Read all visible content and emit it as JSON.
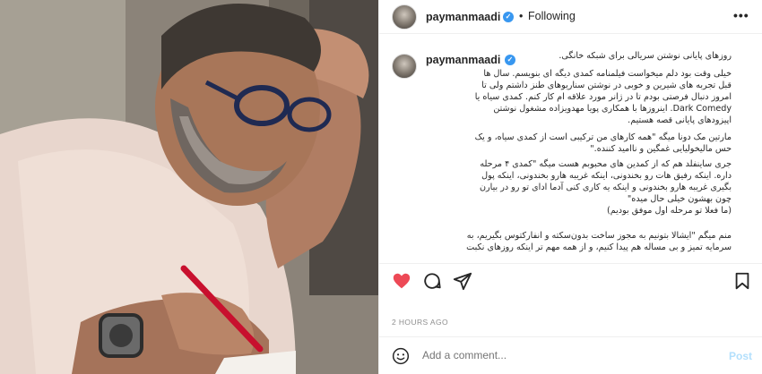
{
  "post": {
    "username": "paymanmaadi",
    "follow_status": "Following",
    "separator": "•",
    "more_icon": "•••",
    "verified_mark": "✓",
    "caption_lines": [
      "روزهای پایانی نوشتن سریالی برای شبکه خانگی.",
      "خیلی وقت بود دلم میخواست فیلمنامه کمدی دیگه ای بنویسم. سال ها",
      "قبل تجربه های شیرین و خوبی در نوشتن سناریوهای طنز داشتم ولی تا",
      "امروز دنبال فرصتی بودم تا در ژانر مورد علاقه ام کار کنم. کمدی سیاه یا",
      "Dark Comedy. اینروزها با همکاری پویا مهدویزاده مشغول نوشتن",
      "اپیزودهای پایانی قصه هستیم.",
      "مارتین مک دونا میگه \"همه کارهای من ترکیبی است از کمدی سیاه، و یک",
      "حس مالیخولیایی غمگین و ناامید کننده.\"",
      "جری ساینفلد هم که از کمدین های محبوبم هست میگه \"کمدی ۴ مرحله",
      "داره. اینکه رفیق هات رو بخندونی، اینکه غریبه هارو بخندونی، اینکه پول",
      "بگیری غریبه هارو بخندونی و اینکه یه کاری کنی آدما ادای تو رو در بیارن",
      "چون بهشون خیلی حال میده\"",
      "(ما فعلا تو مرحله اول موفق بودیم)",
      "",
      "منم میگم \"ایشالا بتونیم به مجوز ساخت بدون‌سکته و انفارکتوس بگیریم، به",
      "سرمایه تمیز و بی مساله هم پیدا کنیم، و از همه مهم تر اینکه روزهای نکبت"
    ],
    "timestamp": "2 HOURS AGO"
  },
  "comment": {
    "placeholder": "Add a comment...",
    "post_label": "Post"
  },
  "colors": {
    "like": "#ed4956",
    "verified": "#3897f0",
    "post_disabled": "#b2dffc",
    "muted": "#8e8e8e"
  },
  "icons": {
    "like": "heart-icon",
    "comment": "comment-icon",
    "share": "send-icon",
    "save": "bookmark-icon",
    "more": "more-options-icon",
    "emoji": "emoji-icon",
    "verified": "verified-badge-icon"
  }
}
